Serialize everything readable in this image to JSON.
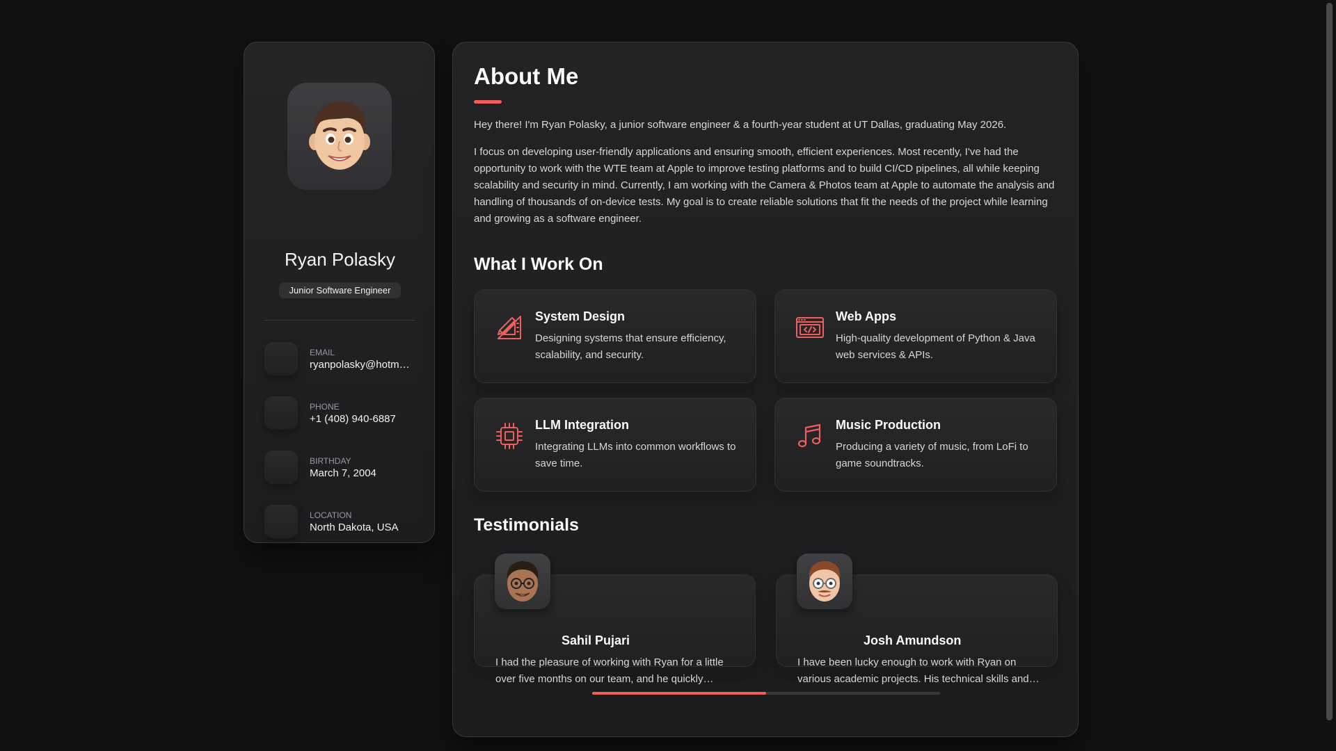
{
  "profile": {
    "name": "Ryan Polasky",
    "title": "Junior Software Engineer",
    "avatar_icon": "memoji-avatar"
  },
  "contacts": [
    {
      "label": "Email",
      "value": "ryanpolasky@hotmail.com",
      "icon": "mail-icon"
    },
    {
      "label": "Phone",
      "value": "+1 (408) 940-6887",
      "icon": "phone-icon"
    },
    {
      "label": "Birthday",
      "value": "March 7, 2004",
      "icon": "calendar-icon"
    },
    {
      "label": "Location",
      "value": "North Dakota, USA",
      "icon": "location-icon"
    }
  ],
  "about": {
    "heading": "About Me",
    "paragraphs": [
      "Hey there! I'm Ryan Polasky, a junior software engineer & a fourth-year student at UT Dallas, graduating May 2026.",
      "I focus on developing user-friendly applications and ensuring smooth, efficient experiences. Most recently, I've had the opportunity to work with the WTE team at Apple to improve testing platforms and to build CI/CD pipelines, all while keeping scalability and security in mind. Currently, I am working with the Camera & Photos team at Apple to automate the analysis and handling of thousands of on-device tests. My goal is to create reliable solutions that fit the needs of the project while learning and growing as a software engineer."
    ]
  },
  "services": {
    "heading": "What I Work On",
    "items": [
      {
        "title": "System Design",
        "text": "Designing systems that ensure efficiency, scalability, and security.",
        "icon": "design-tools-icon"
      },
      {
        "title": "Web Apps",
        "text": "High-quality development of Python & Java web services & APIs.",
        "icon": "code-window-icon"
      },
      {
        "title": "LLM Integration",
        "text": "Integrating LLMs into common workflows to save time.",
        "icon": "chip-icon"
      },
      {
        "title": "Music Production",
        "text": "Producing a variety of music, from LoFi to game soundtracks.",
        "icon": "music-note-icon"
      }
    ]
  },
  "testimonials": {
    "heading": "Testimonials",
    "items": [
      {
        "name": "Sahil Pujari",
        "text": "I had the pleasure of working with Ryan for a little over five months on our team, and he quickly became an invaluable member.",
        "icon": "memoji-avatar"
      },
      {
        "name": "Josh Amundson",
        "text": "I have been lucky enough to work with Ryan on various academic projects. His technical skills and dedication are outstanding.",
        "icon": "memoji-avatar"
      }
    ],
    "carousel_progress": 0.5
  },
  "colors": {
    "accent": "#ef5f5c",
    "background": "#111112",
    "card": "#232325"
  }
}
